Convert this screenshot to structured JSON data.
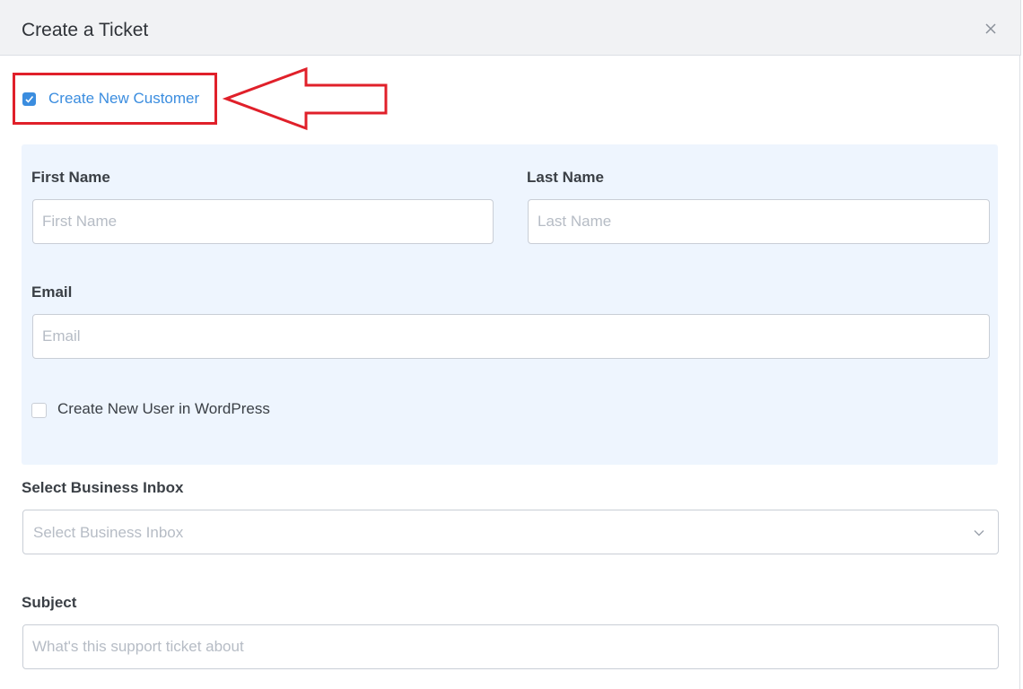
{
  "dialog": {
    "title": "Create a Ticket"
  },
  "create_customer": {
    "label": "Create New Customer",
    "checked": true
  },
  "customer_form": {
    "first_name": {
      "label": "First Name",
      "placeholder": "First Name"
    },
    "last_name": {
      "label": "Last Name",
      "placeholder": "Last Name"
    },
    "email": {
      "label": "Email",
      "placeholder": "Email"
    },
    "create_wp_user": {
      "label": "Create New User in WordPress",
      "checked": false
    }
  },
  "business_inbox": {
    "label": "Select Business Inbox",
    "placeholder": "Select Business Inbox"
  },
  "subject": {
    "label": "Subject",
    "placeholder": "What's this support ticket about"
  },
  "colors": {
    "accent": "#3b8ddf",
    "highlight": "#e0202a",
    "panel_bg": "#eef5fe",
    "header_bg": "#f1f2f4"
  },
  "icons": {
    "close": "close-icon",
    "check": "check-icon",
    "chevron": "chevron-down-icon",
    "arrow": "arrow-left-annotation"
  }
}
